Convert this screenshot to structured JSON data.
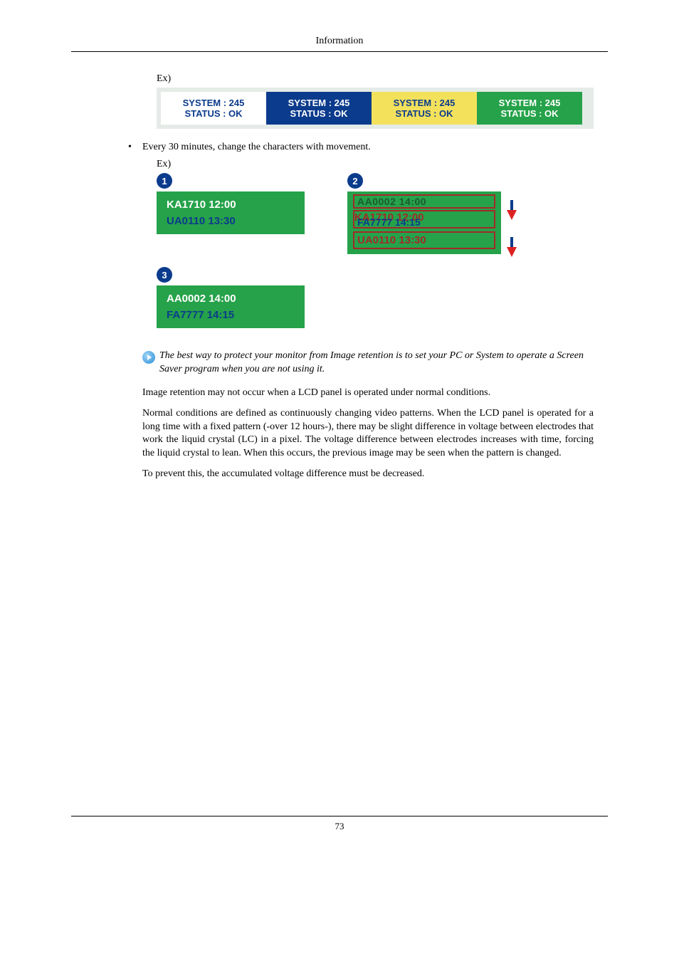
{
  "header": {
    "title": "Information"
  },
  "labels": {
    "ex": "Ex)"
  },
  "tiles": {
    "line1": "SYSTEM : 245",
    "line2": "STATUS : OK"
  },
  "bullet": {
    "text": "Every 30 minutes, change the characters with movement."
  },
  "badges": {
    "one": "1",
    "two": "2",
    "three": "3"
  },
  "panels": {
    "p1": {
      "line1": "KA1710  12:00",
      "line2": "UA0110  13:30"
    },
    "p2": {
      "top": "AA0002  14:00",
      "mid_behind": "KA1710  12:00",
      "mid_front": "FA7777  14:15",
      "bot": "UA0110  13:30"
    },
    "p3": {
      "line1": "AA0002  14:00",
      "line2": "FA7777  14:15"
    }
  },
  "tip": "The best way to protect your monitor from Image retention is to set your PC or System to operate a Screen Saver program when you are not using it.",
  "paras": {
    "p1": "Image retention may not occur when a LCD panel is operated under normal conditions.",
    "p2": "Normal conditions are defined as continuously changing video patterns. When the LCD panel is operated for a long time with a fixed pattern (-over 12 hours-), there may be slight difference in voltage between electrodes that work the liquid crystal (LC) in a pixel. The voltage difference between electrodes increases with time, forcing the liquid crystal to lean. When this occurs, the previous image may be seen when the pattern is changed.",
    "p3": "To prevent this, the accumulated voltage difference must be decreased."
  },
  "footer": {
    "page": "73"
  }
}
